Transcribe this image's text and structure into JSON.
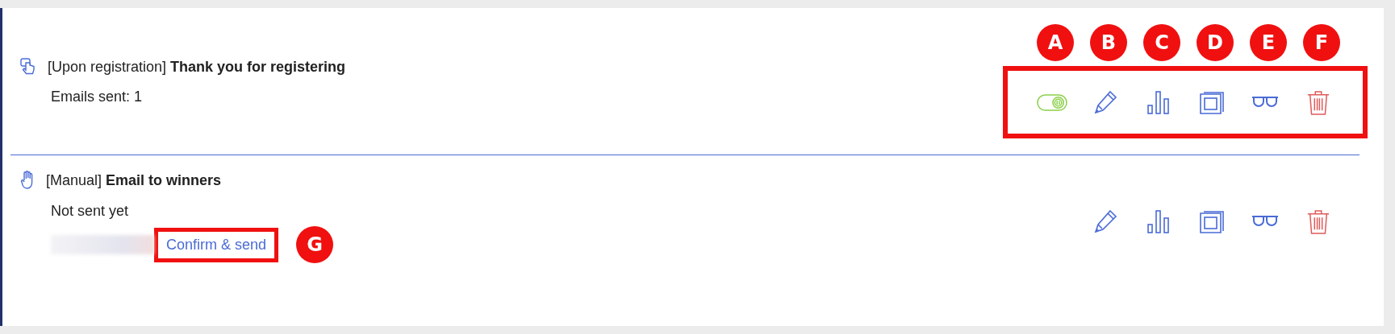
{
  "rows": [
    {
      "trigger": "[Upon registration]",
      "title": "Thank you for registering",
      "status": "Emails sent: 1",
      "kind": "automatic",
      "actions_highlighted": true,
      "actions": [
        {
          "kind": "toggle",
          "on": true,
          "marker": "A"
        },
        {
          "kind": "edit",
          "marker": "B"
        },
        {
          "kind": "stats",
          "marker": "C"
        },
        {
          "kind": "copy",
          "marker": "D"
        },
        {
          "kind": "preview",
          "marker": "E"
        },
        {
          "kind": "delete",
          "marker": "F"
        }
      ]
    },
    {
      "trigger": "[Manual]",
      "title": "Email to winners",
      "status": "Not sent yet",
      "kind": "manual",
      "link": {
        "label": "Confirm & send",
        "highlighted": true,
        "marker": "G",
        "blurred_prefix": true
      },
      "actions": [
        {
          "kind": "edit"
        },
        {
          "kind": "stats"
        },
        {
          "kind": "copy"
        },
        {
          "kind": "preview"
        },
        {
          "kind": "delete"
        }
      ]
    }
  ]
}
